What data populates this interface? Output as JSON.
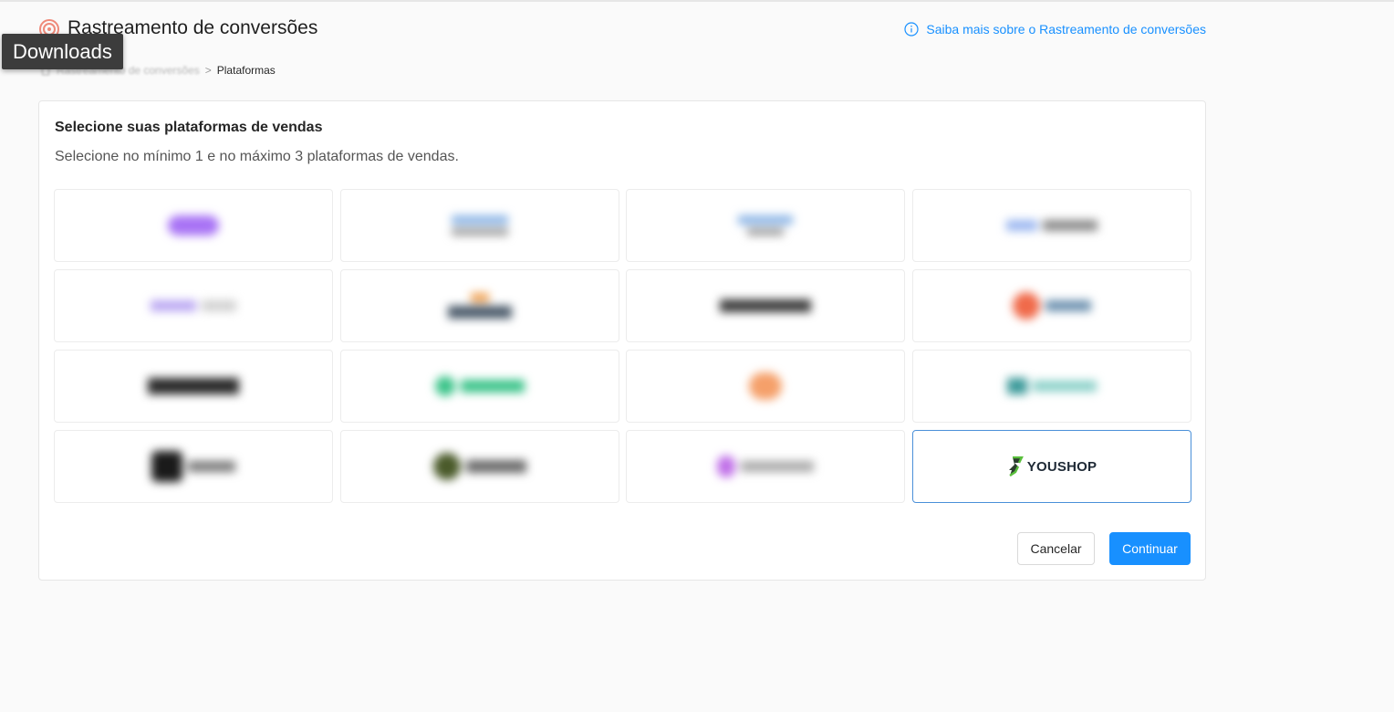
{
  "tooltip": {
    "label": "Downloads"
  },
  "header": {
    "title": "Rastreamento de conversões",
    "help_link": "Saiba mais sobre o Rastreamento de conversões",
    "accent_color": "#1890ff"
  },
  "breadcrumb": {
    "parent": "Rastreamento de conversões",
    "current": "Plataformas"
  },
  "card": {
    "title": "Selecione suas plataformas de vendas",
    "subtitle": "Selecione no mínimo 1 e no máximo 3 plataformas de vendas."
  },
  "platforms": [
    {
      "logo_text": "",
      "blurred": true
    },
    {
      "logo_text": "",
      "blurred": true
    },
    {
      "logo_text": "",
      "blurred": true
    },
    {
      "logo_text": "",
      "blurred": true
    },
    {
      "logo_text": "",
      "blurred": true
    },
    {
      "logo_text": "",
      "blurred": true
    },
    {
      "logo_text": "",
      "blurred": true
    },
    {
      "logo_text": "",
      "blurred": true
    },
    {
      "logo_text": "",
      "blurred": true
    },
    {
      "logo_text": "",
      "blurred": true
    },
    {
      "logo_text": "",
      "blurred": true
    },
    {
      "logo_text": "",
      "blurred": true
    },
    {
      "logo_text": "",
      "blurred": true
    },
    {
      "logo_text": "",
      "blurred": true
    },
    {
      "logo_text": "",
      "blurred": true
    },
    {
      "logo_text": "YOUSHOP",
      "blurred": false,
      "selected": true
    }
  ],
  "buttons": {
    "cancel": "Cancelar",
    "continue": "Continuar"
  }
}
